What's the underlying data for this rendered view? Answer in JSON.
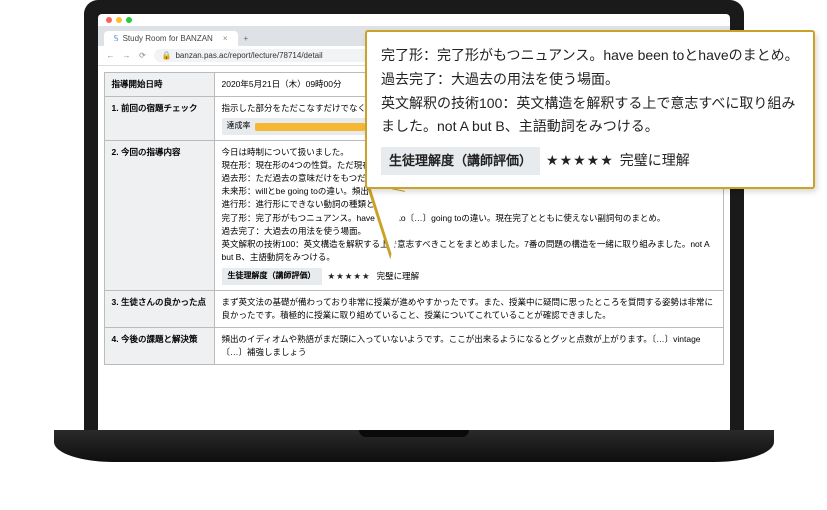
{
  "browser": {
    "tab_title": "Study Room for BANZAN",
    "url": "banzan.pas.ac/report/lecture/78714/detail"
  },
  "rows": {
    "datetime": {
      "label": "指導開始日時",
      "value": "2020年5月21日（木）09時00分"
    },
    "homework": {
      "label": "1. 前回の宿題チェック",
      "text": "指示した部分をただこなすだけでなく、自〔…〕で分かったところと分からなかったところ〔…〕",
      "achieve_label": "達成率",
      "achieve_pct": "100%"
    },
    "content": {
      "label": "2. 今回の指導内容",
      "text1": "今日は時制について扱いました。",
      "text2": "現在形：現在形の4つの性質。ただ現在の〔…〕",
      "text3": "過去形：ただ過去の意味だけをもつだけで〔…〕",
      "text4": "未来形：willとbe going toの違い。頻出表現",
      "text5": "進行形：進行形にできない動詞の種類と演習",
      "text6": "完了形：完了形がもつニュアンス。have been to〔…〕going toの違い。現在完了とともに使えない副詞句のまとめ。",
      "text7": "過去完了：大過去の用法を使う場面。",
      "text8": "英文解釈の技術100：英文構造を解釈する上で意志すべきことをまとめました。7番の問題の構造を一緒に取り組みました。not A but B、主語動詞をみつける。",
      "rating_label": "生徒理解度（講師評価）",
      "rating_text": "完璧に理解"
    },
    "good": {
      "label": "3. 生徒さんの良かった点",
      "text": "まず英文法の基礎が備わっており非常に授業が進めやすかったです。また、授業中に疑問に思ったところを質問する姿勢は非常に良かったです。積極的に授業に取り組めていること、授業についてこれていることが確認できました。"
    },
    "task": {
      "label": "4. 今後の課題と解決策",
      "text": "頻出のイディオムや熟語がまだ頭に入っていないようです。ここが出来るようになるとグッと点数が上がります。〔…〕vintage〔…〕補強しましょう"
    }
  },
  "callout": {
    "line1": "完了形：完了形がもつニュアンス。have been toとhaveのまとめ。",
    "line2": "過去完了：大過去の用法を使う場面。",
    "line3": "英文解釈の技術100：英文構造を解釈する上で意志すべに取り組みました。not A but B、主語動詞をみつける。",
    "rating_label": "生徒理解度（講師評価）",
    "rating_text": "完璧に理解"
  },
  "stars": "★★★★★"
}
